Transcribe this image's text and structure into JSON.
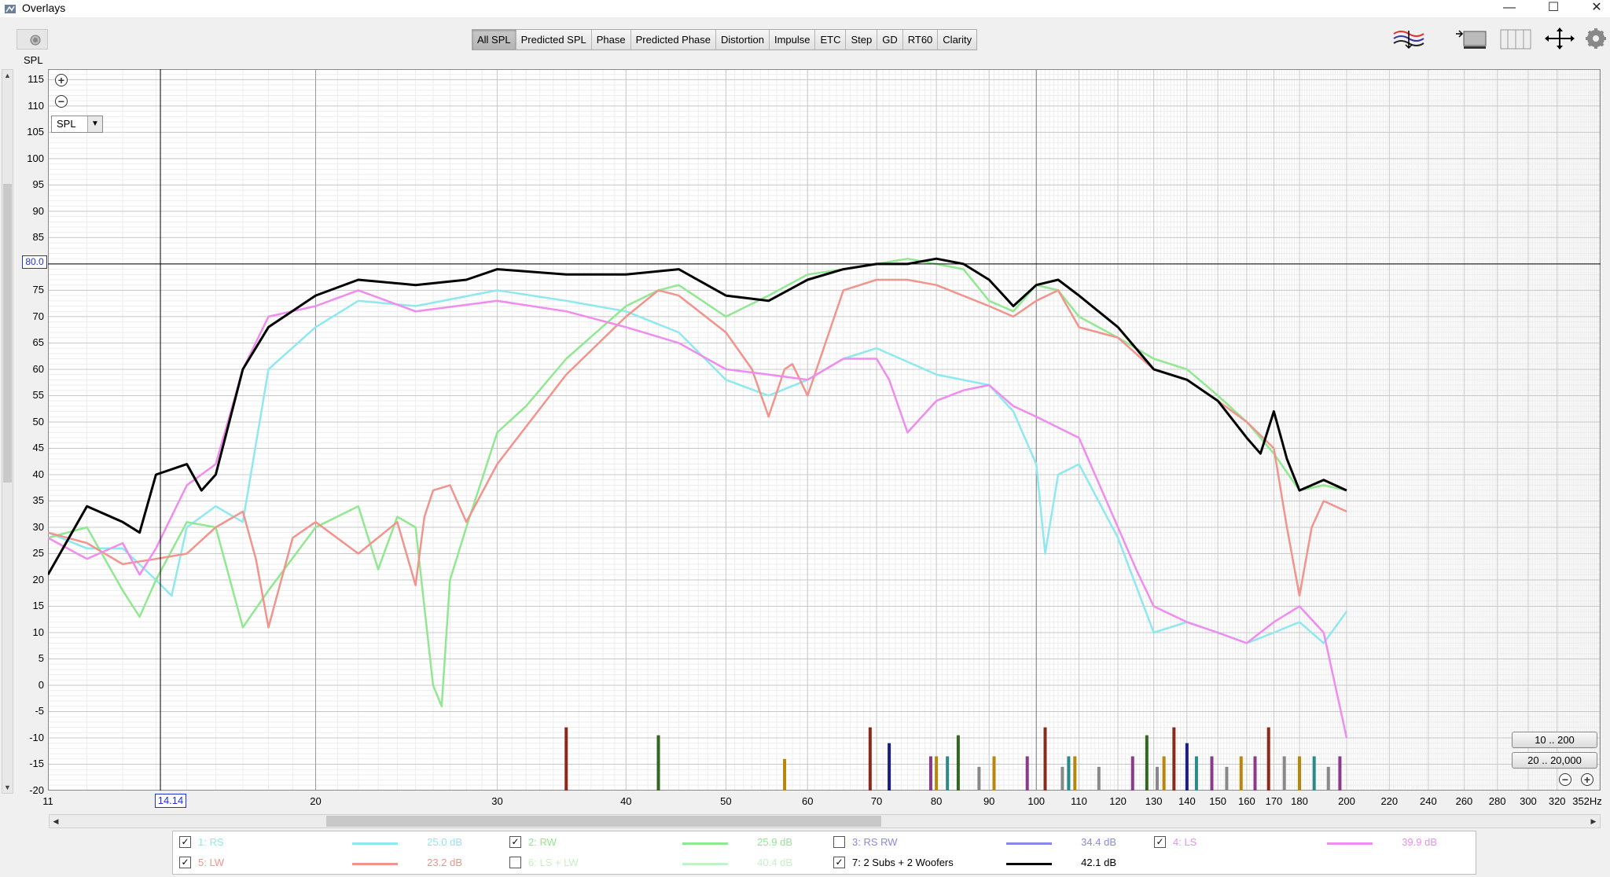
{
  "window": {
    "title": "Overlays",
    "minimize": "—",
    "maximize": "☐",
    "close": "✕"
  },
  "tabs": [
    {
      "label": "All SPL",
      "active": true
    },
    {
      "label": "Predicted SPL"
    },
    {
      "label": "Phase"
    },
    {
      "label": "Predicted Phase"
    },
    {
      "label": "Distortion"
    },
    {
      "label": "Impulse"
    },
    {
      "label": "ETC"
    },
    {
      "label": "Step"
    },
    {
      "label": "GD"
    },
    {
      "label": "RT60"
    },
    {
      "label": "Clarity"
    }
  ],
  "graph": {
    "y_axis_title": "SPL",
    "select_value": "SPL",
    "cursor_x": "14.14",
    "cursor_y": "80.0",
    "range_buttons": [
      "10 .. 200",
      "20 .. 20,000"
    ]
  },
  "chart_data": {
    "type": "line",
    "x_scale": "log",
    "xlim": [
      11,
      352
    ],
    "ylim": [
      -20,
      117
    ],
    "grid": true,
    "x_tick_labels": [
      "11",
      "20",
      "30",
      "40",
      "50",
      "60",
      "70",
      "80",
      "90",
      "100",
      "110",
      "120",
      "130",
      "140",
      "150",
      "160",
      "170",
      "180",
      "200",
      "220",
      "240",
      "260",
      "280",
      "300",
      "320",
      "352Hz"
    ],
    "y_tick_labels": [
      "115",
      "110",
      "105",
      "100",
      "95",
      "90",
      "85",
      "80",
      "75",
      "70",
      "65",
      "60",
      "55",
      "50",
      "45",
      "40",
      "35",
      "30",
      "25",
      "20",
      "15",
      "10",
      "5",
      "0",
      "-5",
      "-10",
      "-15",
      "-20"
    ],
    "series": [
      {
        "name": "1: RS",
        "color": "#8ee8f0",
        "x": [
          11,
          12,
          13,
          14,
          14.5,
          15,
          16,
          17,
          18,
          20,
          22,
          25,
          30,
          35,
          40,
          45,
          50,
          55,
          60,
          65,
          70,
          80,
          90,
          95,
          100,
          102,
          105,
          110,
          120,
          130,
          140,
          150,
          160,
          170,
          180,
          190,
          200
        ],
        "y": [
          29,
          26,
          26,
          20,
          17,
          30,
          34,
          31,
          60,
          68,
          73,
          72,
          75,
          73,
          71,
          67,
          58,
          55,
          58,
          62,
          64,
          59,
          57,
          52,
          42,
          25,
          40,
          42,
          28,
          10,
          12,
          10,
          8,
          10,
          12,
          8,
          14
        ]
      },
      {
        "name": "2: RW",
        "color": "#90e890",
        "x": [
          11,
          12,
          13,
          13.5,
          14,
          15,
          16,
          17,
          18,
          20,
          22,
          23,
          24,
          25,
          26,
          26.5,
          27,
          28,
          30,
          32,
          35,
          40,
          43,
          45,
          50,
          55,
          60,
          65,
          70,
          75,
          80,
          85,
          90,
          95,
          100,
          105,
          110,
          120,
          130,
          140,
          150,
          160,
          170,
          180,
          190,
          200
        ],
        "y": [
          28,
          30,
          18,
          13,
          20,
          31,
          30,
          11,
          18,
          30,
          34,
          22,
          32,
          30,
          0,
          -4,
          20,
          30,
          48,
          53,
          62,
          72,
          75,
          76,
          70,
          74,
          78,
          79,
          80,
          81,
          80,
          79,
          73,
          71,
          76,
          75,
          70,
          66,
          62,
          60,
          55,
          50,
          44,
          37,
          38,
          37
        ]
      },
      {
        "name": "5: LW",
        "color": "#f2938c",
        "x": [
          11,
          12,
          13,
          14,
          15,
          16,
          17,
          17.5,
          18,
          19,
          20,
          22,
          24,
          25,
          25.5,
          26,
          27,
          28,
          30,
          35,
          40,
          43,
          45,
          50,
          53,
          55,
          57,
          58,
          60,
          65,
          70,
          75,
          80,
          90,
          95,
          100,
          105,
          110,
          120,
          130,
          140,
          150,
          160,
          170,
          175,
          180,
          185,
          190,
          200
        ],
        "y": [
          29,
          27,
          23,
          24,
          25,
          30,
          33,
          24,
          11,
          28,
          31,
          25,
          31,
          19,
          32,
          37,
          38,
          31,
          42,
          59,
          70,
          75,
          74,
          67,
          60,
          51,
          60,
          61,
          55,
          75,
          77,
          77,
          76,
          72,
          70,
          73,
          75,
          68,
          66,
          60,
          58,
          54,
          50,
          45,
          30,
          17,
          30,
          35,
          33
        ]
      },
      {
        "name": "4: LS",
        "color": "#f08cf0",
        "x": [
          11,
          12,
          13,
          13.5,
          14,
          15,
          16,
          17,
          18,
          20,
          22,
          25,
          30,
          35,
          40,
          45,
          50,
          55,
          60,
          65,
          70,
          72,
          75,
          80,
          85,
          90,
          95,
          100,
          110,
          120,
          125,
          130,
          140,
          150,
          160,
          170,
          180,
          190,
          200
        ],
        "y": [
          28,
          24,
          27,
          21,
          26,
          38,
          42,
          60,
          70,
          72,
          75,
          71,
          73,
          71,
          68,
          65,
          60,
          59,
          58,
          62,
          62,
          58,
          48,
          54,
          56,
          57,
          53,
          51,
          47,
          30,
          22,
          15,
          12,
          10,
          8,
          12,
          15,
          10,
          -10
        ]
      },
      {
        "name": "7: 2 Subs + 2 Woofers",
        "color": "#000000",
        "x": [
          11,
          12,
          13,
          13.5,
          14,
          15,
          15.5,
          16,
          17,
          18,
          20,
          22,
          25,
          28,
          30,
          35,
          40,
          45,
          50,
          55,
          60,
          65,
          70,
          75,
          80,
          85,
          90,
          95,
          100,
          105,
          110,
          120,
          130,
          140,
          150,
          160,
          165,
          170,
          175,
          180,
          185,
          190,
          200
        ],
        "y": [
          21,
          34,
          31,
          29,
          40,
          42,
          37,
          40,
          60,
          68,
          74,
          77,
          76,
          77,
          79,
          78,
          78,
          79,
          74,
          73,
          77,
          79,
          80,
          80,
          81,
          80,
          77,
          72,
          76,
          77,
          74,
          68,
          60,
          58,
          54,
          47,
          44,
          52,
          43,
          37,
          38,
          39,
          37
        ]
      }
    ],
    "bar_markers": [
      {
        "x": 35,
        "height": -8,
        "color": "#8b2a1a"
      },
      {
        "x": 43,
        "height": -9.5,
        "color": "#336622"
      },
      {
        "x": 57,
        "height": -14,
        "color": "#b8860b"
      },
      {
        "x": 69,
        "height": -8,
        "color": "#8b2a1a"
      },
      {
        "x": 72,
        "height": -11,
        "color": "#1a1a88"
      },
      {
        "x": 79,
        "height": -13.5,
        "color": "#8a3a8a"
      },
      {
        "x": 80,
        "height": -13.5,
        "color": "#b8860b"
      },
      {
        "x": 82,
        "height": -13.5,
        "color": "#2a8a8a"
      },
      {
        "x": 84,
        "height": -9.5,
        "color": "#336622"
      },
      {
        "x": 88,
        "height": -15.5,
        "color": "#888888"
      },
      {
        "x": 91,
        "height": -13.5,
        "color": "#b8860b"
      },
      {
        "x": 98,
        "height": -13.5,
        "color": "#8a3a8a"
      },
      {
        "x": 102,
        "height": -8,
        "color": "#8b2a1a"
      },
      {
        "x": 106,
        "height": -15.5,
        "color": "#888888"
      },
      {
        "x": 107.5,
        "height": -13.5,
        "color": "#2a8a8a"
      },
      {
        "x": 109,
        "height": -13.5,
        "color": "#b8860b"
      },
      {
        "x": 115,
        "height": -15.5,
        "color": "#888888"
      },
      {
        "x": 124,
        "height": -13.5,
        "color": "#8a3a8a"
      },
      {
        "x": 128,
        "height": -9.5,
        "color": "#336622"
      },
      {
        "x": 131,
        "height": -15.5,
        "color": "#888888"
      },
      {
        "x": 133,
        "height": -13.5,
        "color": "#b8860b"
      },
      {
        "x": 136,
        "height": -8,
        "color": "#8b2a1a"
      },
      {
        "x": 140,
        "height": -11,
        "color": "#1a1a88"
      },
      {
        "x": 143,
        "height": -13.5,
        "color": "#2a8a8a"
      },
      {
        "x": 148,
        "height": -13.5,
        "color": "#8a3a8a"
      },
      {
        "x": 153,
        "height": -15.5,
        "color": "#888888"
      },
      {
        "x": 158,
        "height": -13.5,
        "color": "#b8860b"
      },
      {
        "x": 163,
        "height": -13.5,
        "color": "#8a3a8a"
      },
      {
        "x": 168,
        "height": -8,
        "color": "#8b2a1a"
      },
      {
        "x": 174,
        "height": -13.5,
        "color": "#888888"
      },
      {
        "x": 180,
        "height": -13.5,
        "color": "#b8860b"
      },
      {
        "x": 186,
        "height": -13.5,
        "color": "#2a8a8a"
      },
      {
        "x": 192,
        "height": -15.5,
        "color": "#888888"
      },
      {
        "x": 197,
        "height": -13.5,
        "color": "#8a3a8a"
      }
    ]
  },
  "legend": [
    {
      "label": "1: RS",
      "checked": true,
      "color": "#8ee8f0",
      "value": "25.0 dB",
      "faded": true
    },
    {
      "label": "2: RW",
      "checked": true,
      "color": "#90e890",
      "value": "25.9 dB",
      "faded": true
    },
    {
      "label": "3: RS RW",
      "checked": false,
      "color": "#8888e8",
      "value": "34.4 dB",
      "faded": true
    },
    {
      "label": "4: LS",
      "checked": true,
      "color": "#f08cf0",
      "value": "39.9 dB",
      "faded": true
    },
    {
      "label": "5: LW",
      "checked": true,
      "color": "#f2938c",
      "value": "23.2 dB",
      "faded": true
    },
    {
      "label": "6: LS + LW",
      "checked": false,
      "color": "#c8f0c8",
      "value": "40.4 dB",
      "faded": true
    },
    {
      "label": "7: 2 Subs + 2 Woofers",
      "checked": true,
      "color": "#000000",
      "value": "42.1 dB",
      "faded": false
    }
  ]
}
